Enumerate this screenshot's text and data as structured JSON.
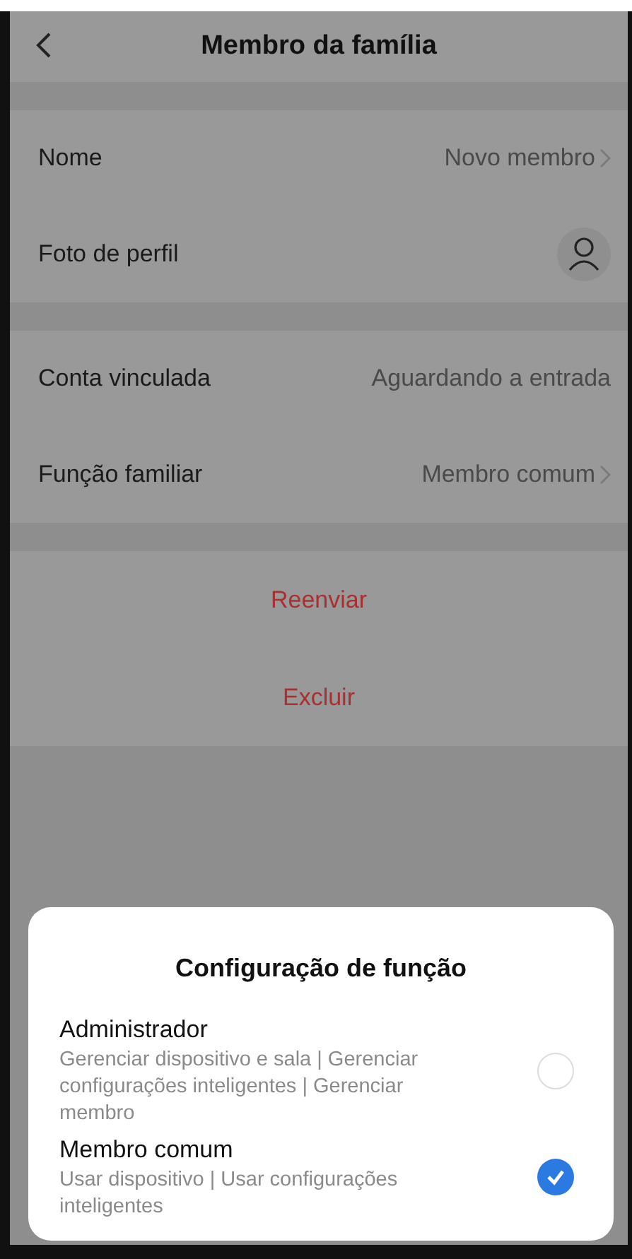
{
  "header": {
    "title": "Membro da família"
  },
  "sections": [
    {
      "rows": [
        {
          "kind": "link",
          "label": "Nome",
          "value": "Novo membro"
        },
        {
          "kind": "avatar",
          "label": "Foto de perfil"
        }
      ]
    },
    {
      "rows": [
        {
          "kind": "text",
          "label": "Conta vinculada",
          "value": "Aguardando a entrada"
        },
        {
          "kind": "link",
          "label": "Função familiar",
          "value": "Membro comum"
        }
      ]
    }
  ],
  "actions": [
    "Reenviar",
    "Excluir"
  ],
  "sheet": {
    "title": "Configuração de função",
    "options": [
      {
        "title": "Administrador",
        "description": "Gerenciar dispositivo e sala | Gerenciar configurações inteligentes | Gerenciar membro",
        "selected": false
      },
      {
        "title": "Membro comum",
        "description": "Usar dispositivo | Usar configurações inteligentes",
        "selected": true
      }
    ]
  }
}
